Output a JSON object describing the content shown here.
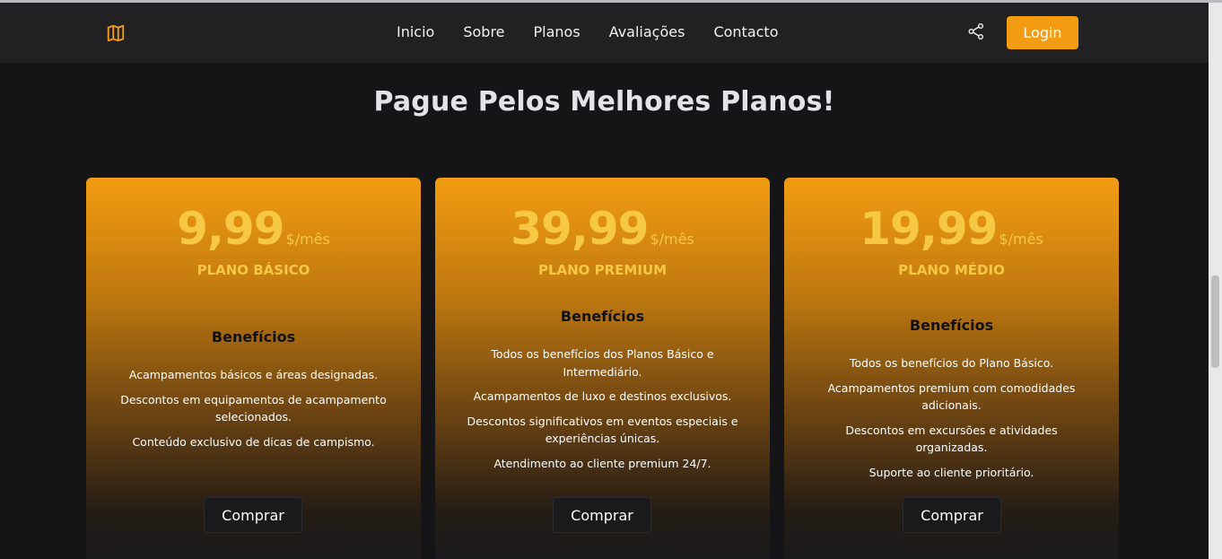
{
  "nav": {
    "items": [
      "Inicio",
      "Sobre",
      "Planos",
      "Avaliações",
      "Contacto"
    ],
    "login_label": "Login"
  },
  "page": {
    "heading": "Pague Pelos Melhores Planos!"
  },
  "plans": [
    {
      "price": "9,99",
      "period": "$/mês",
      "name": "PLANO BÁSICO",
      "benefits_heading": "Benefícios",
      "benefits": [
        "Acampamentos básicos e áreas designadas.",
        "Descontos em equipamentos de acampamento selecionados.",
        "Conteúdo exclusivo de dicas de campismo."
      ],
      "button": "Comprar"
    },
    {
      "price": "39,99",
      "period": "$/mês",
      "name": "PLANO PREMIUM",
      "benefits_heading": "Benefícios",
      "benefits": [
        "Todos os benefícios dos Planos Básico e Intermediário.",
        "Acampamentos de luxo e destinos exclusivos.",
        "Descontos significativos em eventos especiais e experiências únicas.",
        "Atendimento ao cliente premium 24/7."
      ],
      "button": "Comprar"
    },
    {
      "price": "19,99",
      "period": "$/mês",
      "name": "PLANO MÉDIO",
      "benefits_heading": "Benefícios",
      "benefits": [
        "Todos os benefícios do Plano Básico.",
        "Acampamentos premium com comodidades adicionais.",
        "Descontos em excursões e atividades organizadas.",
        "Suporte ao cliente prioritário."
      ],
      "button": "Comprar"
    }
  ],
  "colors": {
    "accent": "#f39c12",
    "price": "#f7c843",
    "background": "#151518",
    "header": "#212124"
  },
  "icons": {
    "logo": "map-icon",
    "share": "share-icon"
  }
}
